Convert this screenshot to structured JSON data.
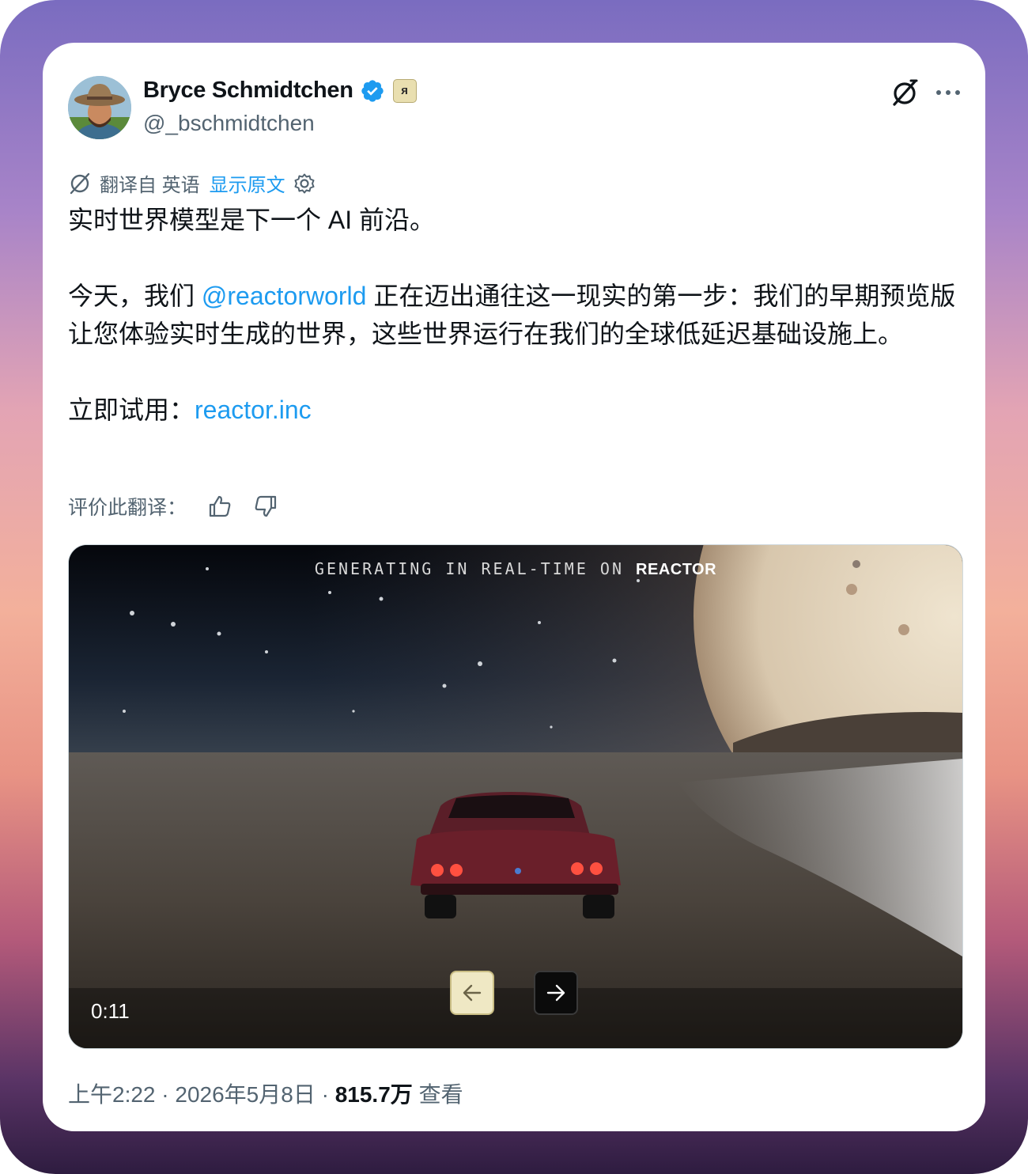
{
  "post": {
    "author_name": "Bryce Schmidtchen",
    "author_handle": "@_bschmidtchen",
    "affiliate_badge": "ᴙ",
    "translation": {
      "label": "翻译自 英语",
      "show_original": "显示原文"
    },
    "text": {
      "line1": "实时世界模型是下一个 AI 前沿。",
      "p2_before": "今天，我们 ",
      "mention": "@reactorworld",
      "p2_after": " 正在迈出通往这一现实的第一步：我们的早期预览版让您体验实时生成的世界，这些世界运行在我们的全球低延迟基础设施上。",
      "try_label": "立即试用：",
      "try_link": "reactor.inc"
    },
    "rate_label": "评价此翻译：",
    "media": {
      "overlay_prefix": "GENERATING IN REAL-TIME ON ",
      "overlay_brand": "REACTOR",
      "duration": "0:11"
    },
    "meta": {
      "time": "上午2:22",
      "date": "2026年5月8日",
      "views_count": "815.7万",
      "views_label": "查看"
    }
  },
  "icons": {
    "verified": "verified-badge-icon",
    "grok": "grok-icon",
    "more": "more-icon",
    "translate": "translate-icon",
    "settings": "gear-icon",
    "thumbs_up": "thumbs-up-icon",
    "thumbs_down": "thumbs-down-icon",
    "arrow_left": "arrow-left-icon",
    "arrow_right": "arrow-right-icon"
  },
  "colors": {
    "link": "#1d9bf0",
    "verified": "#1d9bf0",
    "text": "#0f1419",
    "secondary": "#536471"
  }
}
